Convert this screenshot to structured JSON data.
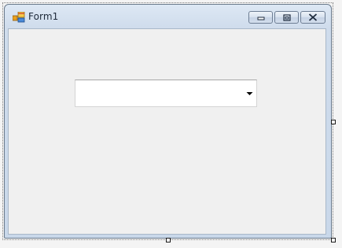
{
  "window": {
    "title": "Form1",
    "icon": "form-app-icon",
    "buttons": {
      "minimize_icon": "minimize-icon",
      "restore_icon": "restore-icon",
      "close_icon": "close-icon"
    }
  },
  "combobox": {
    "value": "",
    "arrow_icon": "dropdown-arrow-icon"
  },
  "designer": {
    "resize_handles": [
      "right",
      "bottom",
      "bottom-right"
    ]
  },
  "colors": {
    "titlebar_top": "#dde8f4",
    "client_background": "#f0f0f0",
    "frame_border": "#6a7a8c"
  }
}
